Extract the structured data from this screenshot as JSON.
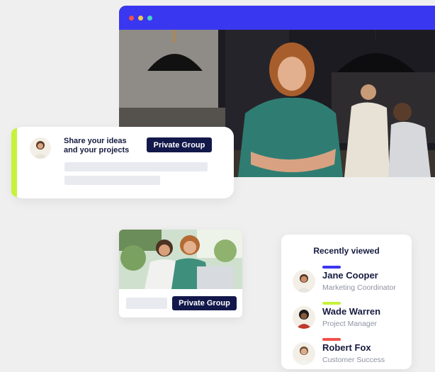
{
  "colors": {
    "browser_bar": "#3a37f0",
    "accent_lime": "#c6f23a",
    "pill": "#12184a",
    "blue_bar": "#3a37f0",
    "lime_bar": "#c6f23a",
    "red_bar": "#f0524a"
  },
  "browser": {
    "dots": [
      "#f0524a",
      "#f2c94c",
      "#4ad4c4"
    ]
  },
  "share_card": {
    "title": "Share your ideas and your projects",
    "button": "Private Group"
  },
  "photo_card": {
    "button": "Private Group"
  },
  "recently_viewed": {
    "title": "Recently viewed",
    "people": [
      {
        "name": "Jane Cooper",
        "role": "Marketing Coordinator",
        "bar_color": "#3a37f0"
      },
      {
        "name": "Wade Warren",
        "role": "Project Manager",
        "bar_color": "#c6f23a"
      },
      {
        "name": "Robert Fox",
        "role": "Customer Success",
        "bar_color": "#f0524a"
      }
    ]
  }
}
